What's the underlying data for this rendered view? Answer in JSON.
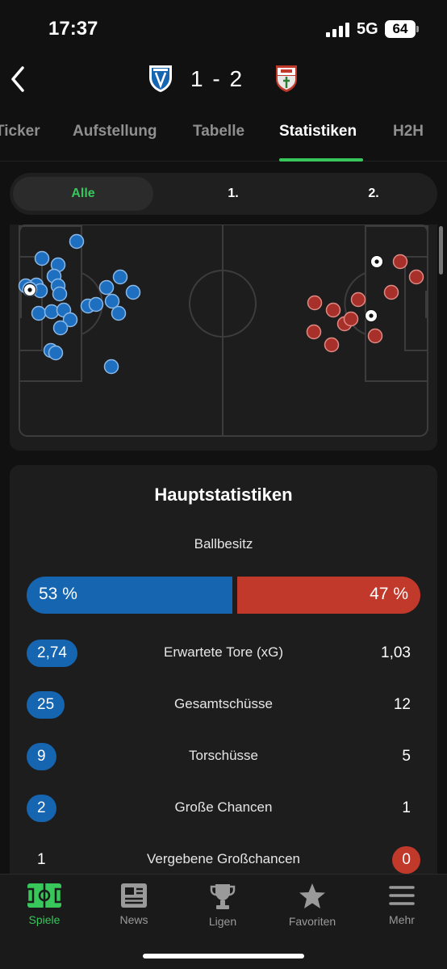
{
  "status_bar": {
    "time": "17:37",
    "network": "5G",
    "battery": "64"
  },
  "header": {
    "back_icon": "chevron-left-icon",
    "home_crest": "vfl-bochum-crest-icon",
    "away_crest": "fc-augsburg-crest-icon",
    "score": "1 - 2",
    "colors": {
      "home": "#1565b0",
      "away": "#c0392b"
    }
  },
  "tabs": [
    {
      "label": "Ticker",
      "active": false
    },
    {
      "label": "Aufstellung",
      "active": false
    },
    {
      "label": "Tabelle",
      "active": false
    },
    {
      "label": "Statistiken",
      "active": true
    },
    {
      "label": "H2H",
      "active": false
    }
  ],
  "periods": [
    {
      "label": "Alle",
      "active": true
    },
    {
      "label": "1.",
      "active": false
    },
    {
      "label": "2.",
      "active": false
    }
  ],
  "shot_map": {
    "home_shots": 25,
    "away_shots": 12,
    "home_goal_marker": "football-icon",
    "away_goal_markers": 2
  },
  "stats": {
    "title": "Hauptstatistiken",
    "possession": {
      "label": "Ballbesitz",
      "home": "53 %",
      "away": "47 %",
      "home_fraction": 0.53
    },
    "rows": [
      {
        "label": "Erwartete Tore (xG)",
        "home": "2,74",
        "away": "1,03",
        "leader": "home"
      },
      {
        "label": "Gesamtschüsse",
        "home": "25",
        "away": "12",
        "leader": "home"
      },
      {
        "label": "Torschüsse",
        "home": "9",
        "away": "5",
        "leader": "home"
      },
      {
        "label": "Große Chancen",
        "home": "2",
        "away": "1",
        "leader": "home"
      },
      {
        "label": "Vergebene Großchancen",
        "home": "1",
        "away": "0",
        "leader": "away"
      }
    ]
  },
  "bottom_nav": [
    {
      "label": "Spiele",
      "icon": "pitch-icon",
      "active": true
    },
    {
      "label": "News",
      "icon": "newspaper-icon",
      "active": false
    },
    {
      "label": "Ligen",
      "icon": "trophy-icon",
      "active": false
    },
    {
      "label": "Favoriten",
      "icon": "star-icon",
      "active": false
    },
    {
      "label": "Mehr",
      "icon": "menu-icon",
      "active": false
    }
  ]
}
